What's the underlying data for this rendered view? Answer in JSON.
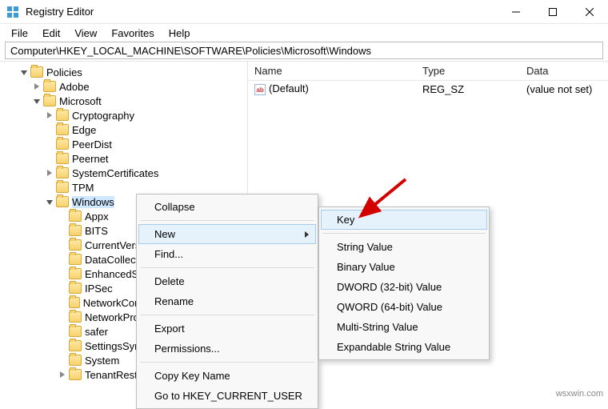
{
  "window": {
    "title": "Registry Editor"
  },
  "menubar": {
    "items": [
      "File",
      "Edit",
      "View",
      "Favorites",
      "Help"
    ]
  },
  "address": {
    "path": "Computer\\HKEY_LOCAL_MACHINE\\SOFTWARE\\Policies\\Microsoft\\Windows"
  },
  "tree": {
    "policies": "Policies",
    "adobe": "Adobe",
    "microsoft": "Microsoft",
    "l3": {
      "0": "Cryptography",
      "1": "Edge",
      "2": "PeerDist",
      "3": "Peernet",
      "4": "SystemCertificates",
      "5": "TPM",
      "6": "Windows"
    },
    "l4": {
      "0": "Appx",
      "1": "BITS",
      "2": "CurrentVersion",
      "3": "DataCollection",
      "4": "EnhancedStorageDevices",
      "5": "IPSec",
      "6": "NetworkConnectivityStatusIndicator",
      "7": "NetworkProvider",
      "8": "safer",
      "9": "SettingsSync",
      "10": "System",
      "11": "TenantRestrictions"
    }
  },
  "values": {
    "head": {
      "name": "Name",
      "type": "Type",
      "data": "Data"
    },
    "row0": {
      "icon": "ab",
      "name": "(Default)",
      "type": "REG_SZ",
      "data": "(value not set)"
    }
  },
  "ctxmenu": {
    "collapse": "Collapse",
    "new": "New",
    "find": "Find...",
    "delete": "Delete",
    "rename": "Rename",
    "export": "Export",
    "permissions": "Permissions...",
    "copykey": "Copy Key Name",
    "goto": "Go to HKEY_CURRENT_USER"
  },
  "submenu": {
    "key": "Key",
    "string": "String Value",
    "binary": "Binary Value",
    "dword": "DWORD (32-bit) Value",
    "qword": "QWORD (64-bit) Value",
    "multi": "Multi-String Value",
    "expand": "Expandable String Value"
  },
  "watermark": "wsxwin.com"
}
